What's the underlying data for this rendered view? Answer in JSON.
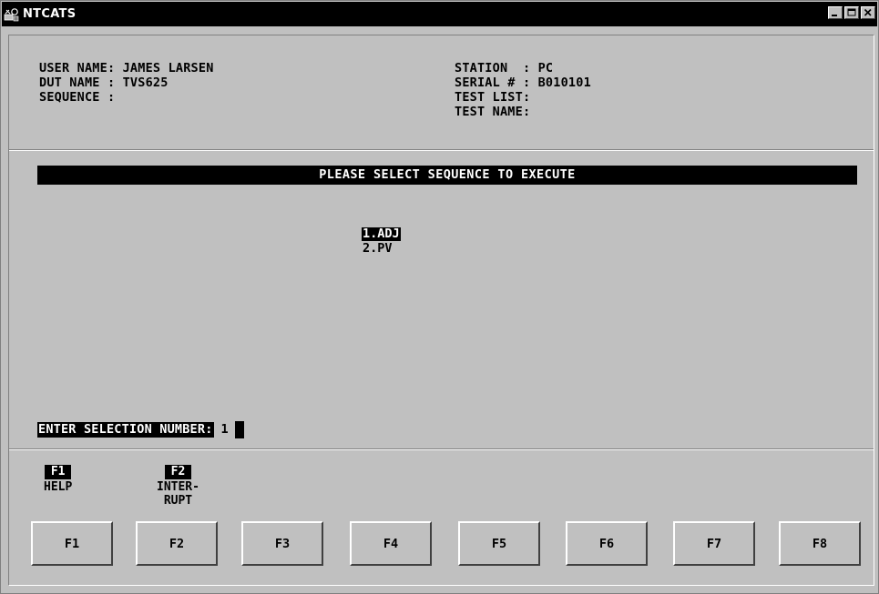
{
  "window": {
    "title": "NTCATS",
    "app_icon": "ntcats-app-icon",
    "controls": [
      "minimize-icon",
      "maximize-icon",
      "close-icon"
    ]
  },
  "header": {
    "user_name": "USER NAME: JAMES LARSEN",
    "dut_name": "DUT NAME : TVS625",
    "sequence": "SEQUENCE :",
    "station": "STATION  : PC",
    "serial": "SERIAL # : B010101",
    "test_list": "TEST LIST:",
    "test_name": "TEST NAME:"
  },
  "prompt": {
    "title": "PLEASE SELECT SEQUENCE TO EXECUTE",
    "items": [
      {
        "label": "1.ADJ",
        "selected": true
      },
      {
        "label": "2.PV",
        "selected": false
      }
    ]
  },
  "selection": {
    "label": "ENTER SELECTION NUMBER:",
    "value": "1"
  },
  "legend": [
    {
      "key": "F1",
      "desc": "HELP"
    },
    {
      "key": "F2",
      "desc": "INTER-\nRUPT"
    }
  ],
  "function_keys": [
    "F1",
    "F2",
    "F3",
    "F4",
    "F5",
    "F6",
    "F7",
    "F8"
  ],
  "colors": {
    "background": "#c0c0c0",
    "titlebar": "#000000",
    "highlight": "#000000",
    "highlight_text": "#ffffff"
  }
}
